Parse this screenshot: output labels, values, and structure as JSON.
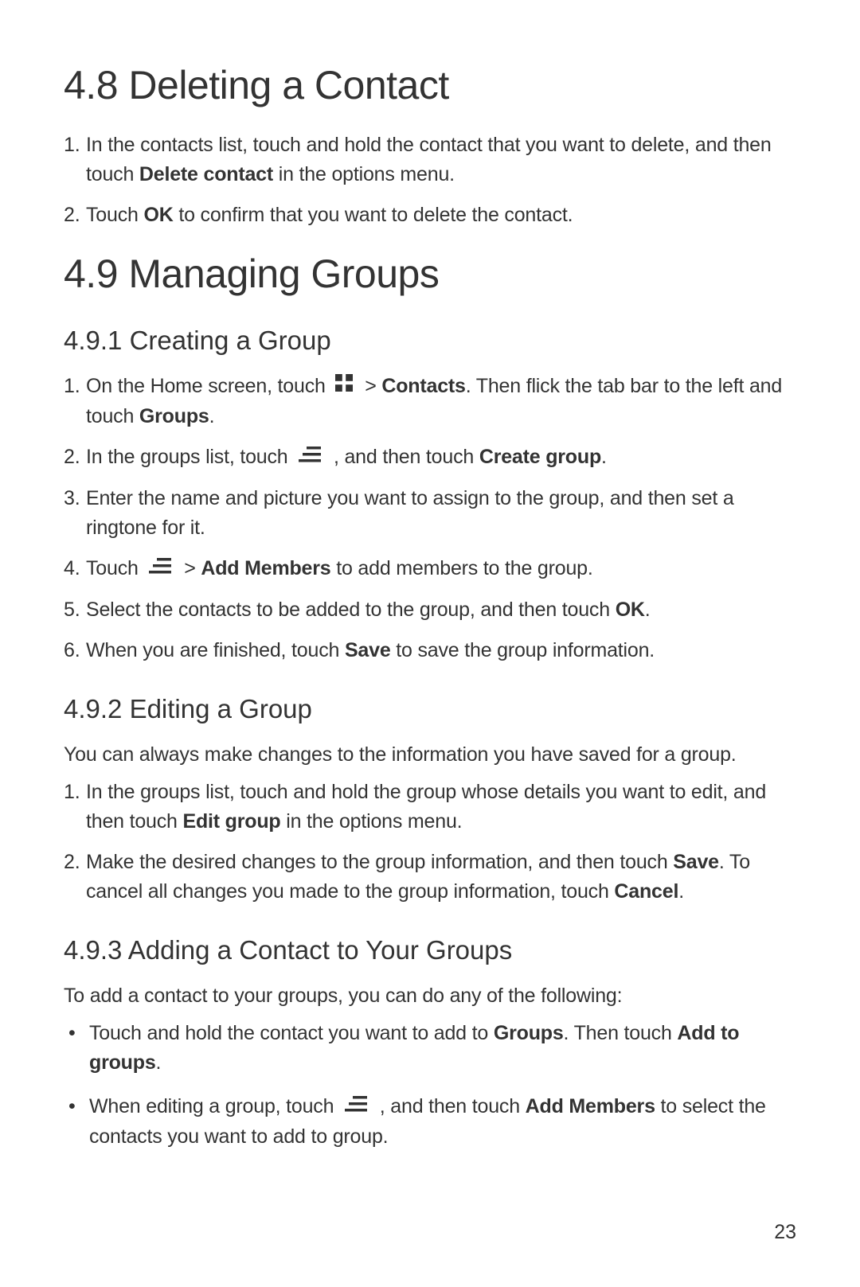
{
  "page_number": "23",
  "sec48": {
    "title": "4.8  Deleting a Contact",
    "items": [
      {
        "num": "1.",
        "parts": [
          {
            "t": "In the contacts list, touch and hold the contact that you want to delete, and then touch "
          },
          {
            "t": "Delete contact",
            "b": true
          },
          {
            "t": " in the options menu."
          }
        ]
      },
      {
        "num": "2.",
        "parts": [
          {
            "t": "Touch "
          },
          {
            "t": "OK",
            "b": true
          },
          {
            "t": " to confirm that you want to delete the contact."
          }
        ]
      }
    ]
  },
  "sec49": {
    "title": "4.9  Managing Groups",
    "s1": {
      "title": "4.9.1  Creating a Group",
      "items": [
        {
          "num": "1.",
          "parts": [
            {
              "t": "On the Home screen, touch "
            },
            {
              "icon": "apps"
            },
            {
              "t": " > "
            },
            {
              "t": "Contacts",
              "b": true
            },
            {
              "t": ". Then flick the tab bar to the left and touch "
            },
            {
              "t": "Groups",
              "b": true
            },
            {
              "t": "."
            }
          ]
        },
        {
          "num": "2.",
          "parts": [
            {
              "t": "In the groups list, touch "
            },
            {
              "icon": "menu"
            },
            {
              "t": " , and then touch "
            },
            {
              "t": "Create group",
              "b": true
            },
            {
              "t": "."
            }
          ]
        },
        {
          "num": "3.",
          "parts": [
            {
              "t": "Enter the name and picture you want to assign to the group, and then set a ringtone for it."
            }
          ]
        },
        {
          "num": "4.",
          "parts": [
            {
              "t": "Touch "
            },
            {
              "icon": "menu"
            },
            {
              "t": " > "
            },
            {
              "t": "Add Members",
              "b": true
            },
            {
              "t": " to add members to the group."
            }
          ]
        },
        {
          "num": "5.",
          "parts": [
            {
              "t": "Select the contacts to be added to the group, and then touch "
            },
            {
              "t": "OK",
              "b": true
            },
            {
              "t": "."
            }
          ]
        },
        {
          "num": "6.",
          "parts": [
            {
              "t": "When you are finished, touch "
            },
            {
              "t": "Save",
              "b": true
            },
            {
              "t": " to save the group information."
            }
          ]
        }
      ]
    },
    "s2": {
      "title": "4.9.2  Editing a Group",
      "intro": "You can always make changes to the information you have saved for a group.",
      "items": [
        {
          "num": "1.",
          "parts": [
            {
              "t": "In the groups list, touch and hold the group whose details you want to edit, and then touch "
            },
            {
              "t": "Edit group",
              "b": true
            },
            {
              "t": " in the options menu."
            }
          ]
        },
        {
          "num": "2.",
          "parts": [
            {
              "t": "Make the desired changes to the group information, and then touch "
            },
            {
              "t": "Save",
              "b": true
            },
            {
              "t": ". To cancel all changes you made to the group information, touch "
            },
            {
              "t": "Cancel",
              "b": true
            },
            {
              "t": "."
            }
          ]
        }
      ]
    },
    "s3": {
      "title": "4.9.3  Adding a Contact to Your Groups",
      "intro": "To add a contact to your groups, you can do any of the following:",
      "bullets": [
        {
          "parts": [
            {
              "t": "Touch and hold the contact you want to add to "
            },
            {
              "t": "Groups",
              "b": true
            },
            {
              "t": ". Then touch "
            },
            {
              "t": "Add to groups",
              "b": true
            },
            {
              "t": "."
            }
          ]
        },
        {
          "parts": [
            {
              "t": "When editing a group, touch "
            },
            {
              "icon": "menu"
            },
            {
              "t": " , and then touch "
            },
            {
              "t": "Add Members",
              "b": true
            },
            {
              "t": " to select the contacts you want to add to group."
            }
          ]
        }
      ]
    }
  }
}
